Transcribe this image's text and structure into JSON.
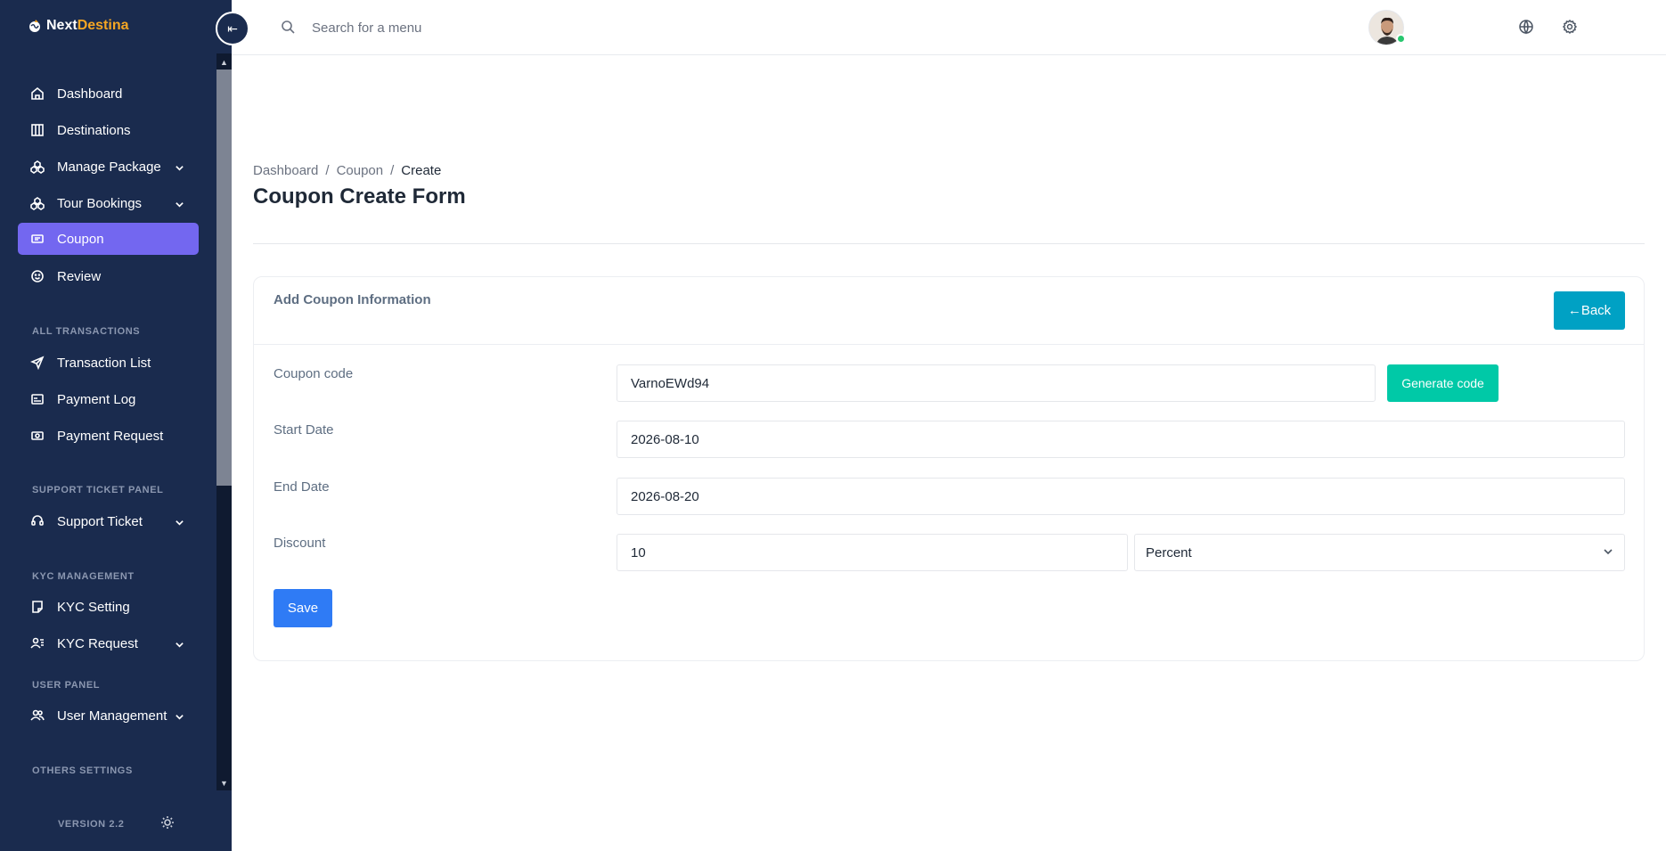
{
  "brand": {
    "name_part1": "Next",
    "name_part2": "Destina"
  },
  "sidebar": {
    "items": [
      {
        "label": "Dashboard",
        "icon": "home-icon"
      },
      {
        "label": "Destinations",
        "icon": "map-icon"
      },
      {
        "label": "Manage Package",
        "icon": "packages-icon",
        "has_submenu": true
      },
      {
        "label": "Tour Bookings",
        "icon": "packages-icon",
        "has_submenu": true
      },
      {
        "label": "Coupon",
        "icon": "ticket-icon",
        "active": true
      },
      {
        "label": "Review",
        "icon": "smile-icon"
      }
    ],
    "sections": {
      "transactions": {
        "title": "ALL TRANSACTIONS",
        "items": [
          {
            "label": "Transaction List",
            "icon": "send-icon"
          },
          {
            "label": "Payment Log",
            "icon": "card-icon"
          },
          {
            "label": "Payment Request",
            "icon": "cash-icon"
          }
        ]
      },
      "support": {
        "title": "SUPPORT TICKET PANEL",
        "items": [
          {
            "label": "Support Ticket",
            "icon": "headset-icon",
            "has_submenu": true
          }
        ]
      },
      "kyc": {
        "title": "KYC MANAGEMENT",
        "items": [
          {
            "label": "KYC Setting",
            "icon": "note-icon"
          },
          {
            "label": "KYC Request",
            "icon": "user-list-icon",
            "has_submenu": true
          }
        ]
      },
      "user_panel": {
        "title": "USER PANEL",
        "items": [
          {
            "label": "User Management",
            "icon": "users-icon",
            "has_submenu": true
          }
        ]
      },
      "others": {
        "title": "OTHERS SETTINGS"
      }
    },
    "version": "VERSION 2.2"
  },
  "topbar": {
    "search_placeholder": "Search for a menu"
  },
  "breadcrumb": {
    "item1": "Dashboard",
    "sep": "/",
    "item2": "Coupon",
    "current": "Create"
  },
  "page_title": "Coupon Create Form",
  "form": {
    "card_title": "Add Coupon Information",
    "back_label": "←Back",
    "coupon_code": {
      "label": "Coupon code",
      "value": "VarnoEWd94"
    },
    "generate_label": "Generate code",
    "start_date": {
      "label": "Start Date",
      "value": "2026-08-10"
    },
    "end_date": {
      "label": "End Date",
      "value": "2026-08-20"
    },
    "discount": {
      "label": "Discount",
      "value": "10",
      "type": "Percent"
    },
    "save_label": "Save"
  },
  "colors": {
    "sidebar_bg": "#1a2b4e",
    "active": "#7367f0",
    "back_btn": "#00a1c4",
    "generate_btn": "#00c9a7",
    "save_btn": "#2f7bf5"
  }
}
